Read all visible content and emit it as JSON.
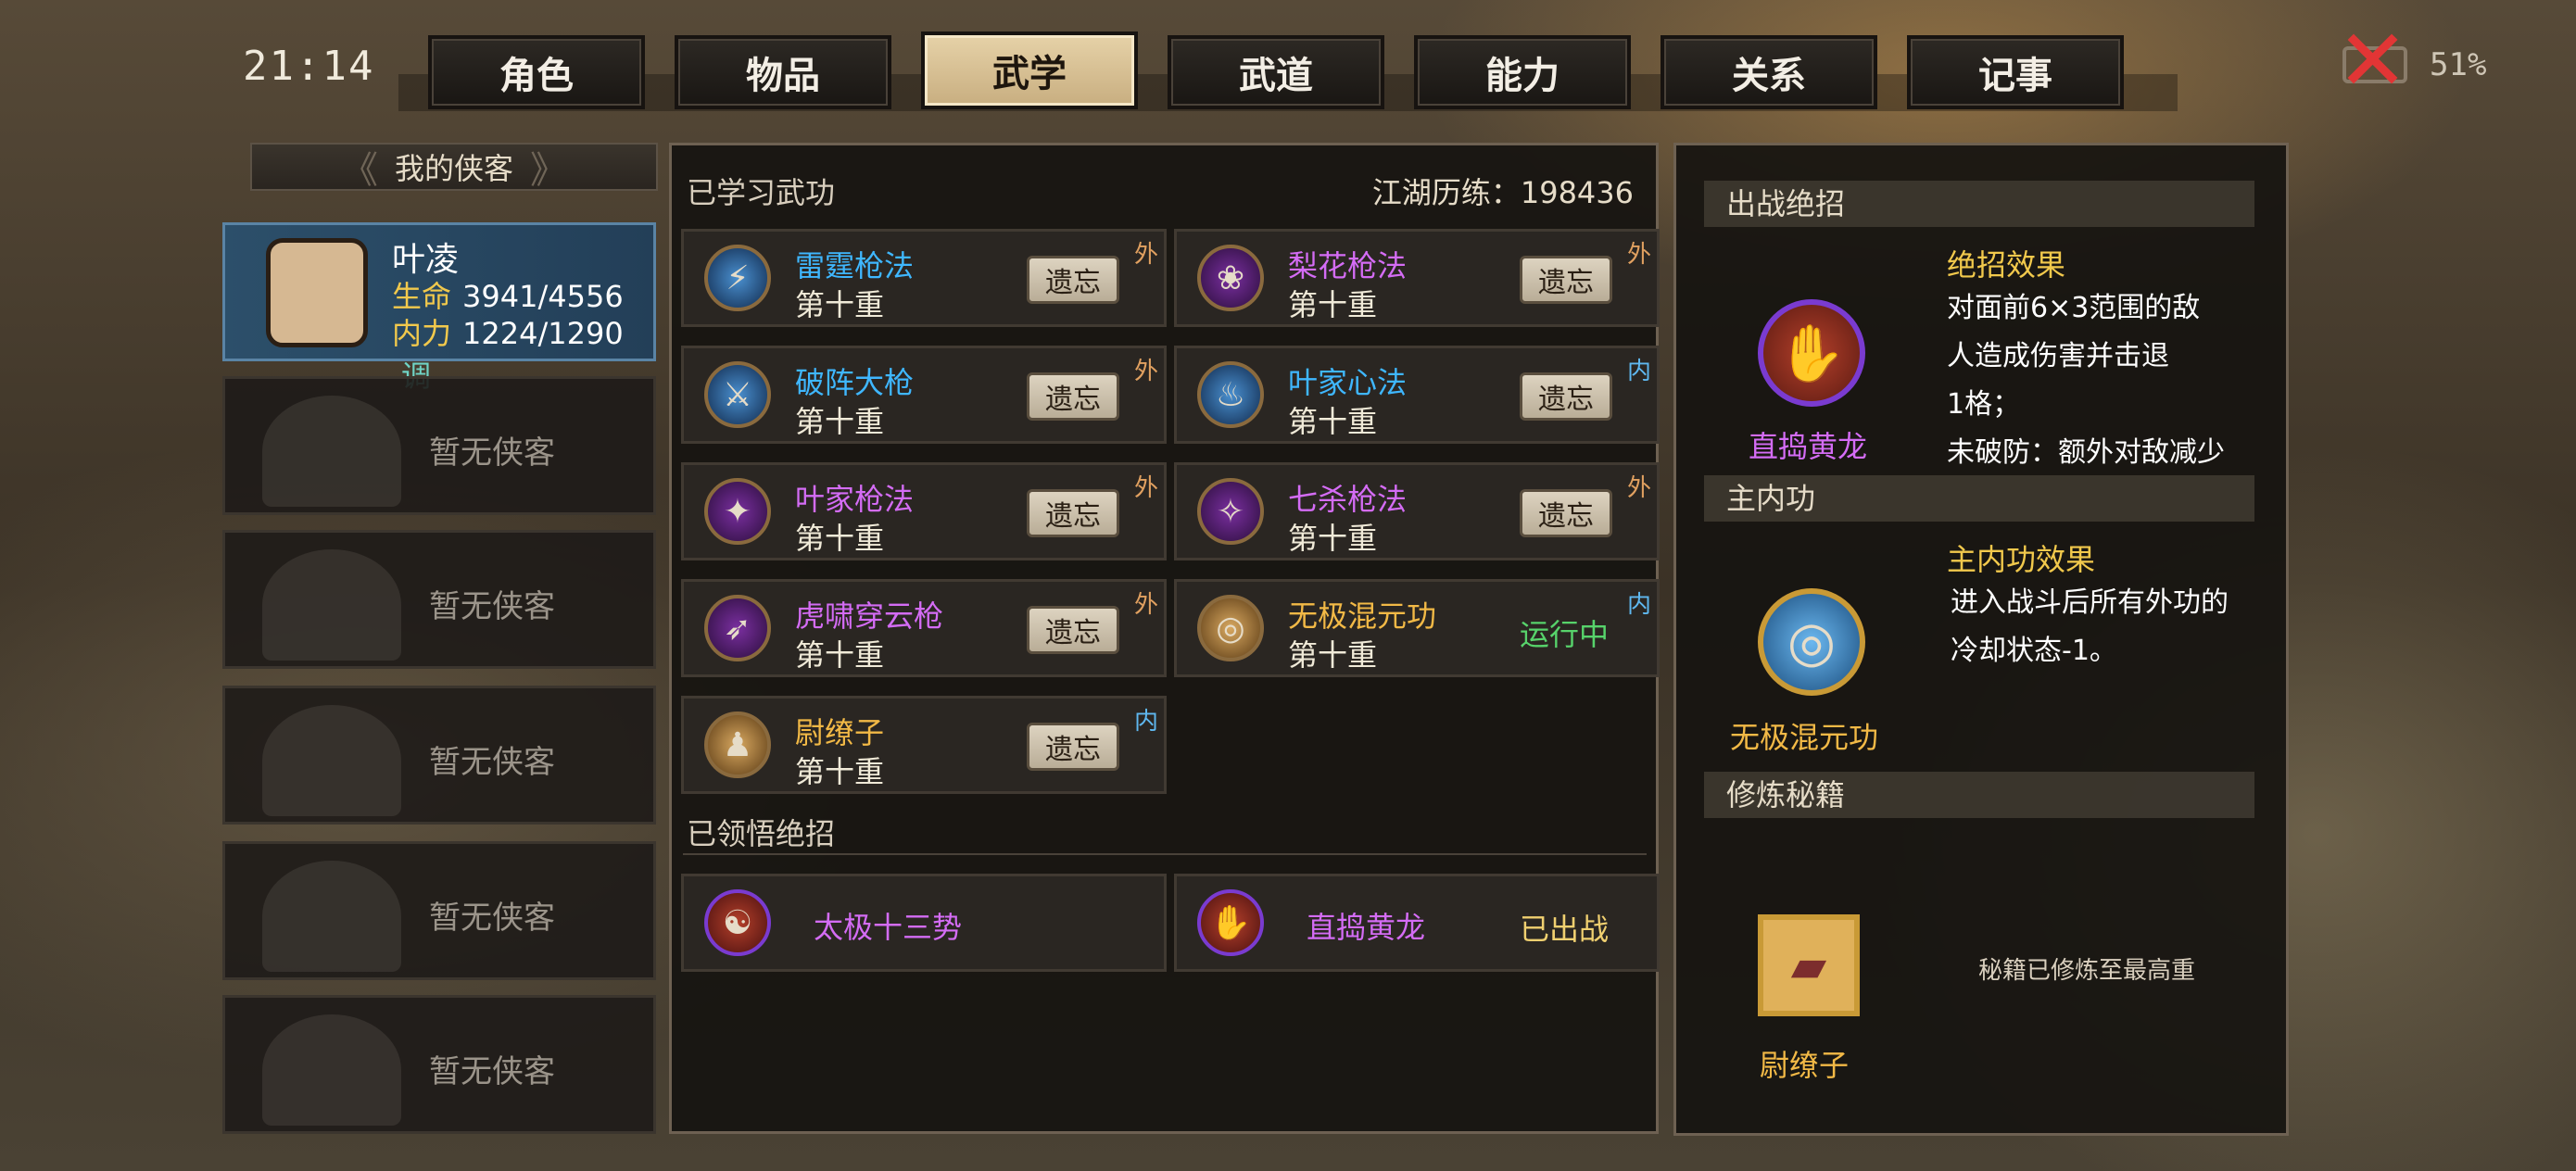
{
  "status": {
    "time": "21:14",
    "battery": "51%"
  },
  "tabs": [
    {
      "label": "角色",
      "active": false
    },
    {
      "label": "物品",
      "active": false
    },
    {
      "label": "武学",
      "active": true
    },
    {
      "label": "武道",
      "active": false
    },
    {
      "label": "能力",
      "active": false
    },
    {
      "label": "关系",
      "active": false
    },
    {
      "label": "记事",
      "active": false
    }
  ],
  "party": {
    "title": "我的侠客",
    "hero": {
      "name": "叶凌",
      "hp_label": "生命",
      "hp": "3941/4556",
      "mp_label": "内力",
      "mp": "1224/1290",
      "tune": "调"
    },
    "empty_label": "暂无侠客"
  },
  "learned": {
    "title": "已学习武功",
    "jianghu_label": "江湖历练：",
    "jianghu_value": "198436",
    "forget_label": "遗忘",
    "running_label": "运行中",
    "skills": [
      {
        "name": "雷霆枪法",
        "level": "第十重",
        "tag": "外",
        "color": "cyan",
        "icon": "lightning-spear-icon"
      },
      {
        "name": "梨花枪法",
        "level": "第十重",
        "tag": "外",
        "color": "purple",
        "icon": "pear-blossom-spear-icon"
      },
      {
        "name": "破阵大枪",
        "level": "第十重",
        "tag": "外",
        "color": "cyan",
        "icon": "formation-spear-icon"
      },
      {
        "name": "叶家心法",
        "level": "第十重",
        "tag": "内",
        "color": "cyan",
        "icon": "meditation-icon"
      },
      {
        "name": "叶家枪法",
        "level": "第十重",
        "tag": "外",
        "color": "purple",
        "icon": "ye-spear-icon"
      },
      {
        "name": "七杀枪法",
        "level": "第十重",
        "tag": "外",
        "color": "purple",
        "icon": "seven-kill-spear-icon"
      },
      {
        "name": "虎啸穿云枪",
        "level": "第十重",
        "tag": "外",
        "color": "purple",
        "icon": "tiger-spear-icon"
      },
      {
        "name": "无极混元功",
        "level": "第十重",
        "tag": "内",
        "color": "gold",
        "icon": "swirl-icon",
        "running": true
      },
      {
        "name": "尉缭子",
        "level": "第十重",
        "tag": "内",
        "color": "gold",
        "icon": "book-sage-icon"
      }
    ]
  },
  "ultimates": {
    "title": "已领悟绝招",
    "items": [
      {
        "name": "太极十三势",
        "icon": "taiji-icon",
        "status": ""
      },
      {
        "name": "直捣黄龙",
        "icon": "claw-strike-icon",
        "status": "已出战"
      }
    ]
  },
  "right": {
    "battle_title": "出战绝招",
    "battle_name": "直捣黄龙",
    "battle_effect_title": "绝招效果",
    "battle_effect_lines": [
      "对面前6×3范围的敌",
      "人造成伤害并击退",
      "1格；",
      "未破防：额外对敌减少"
    ],
    "inner_title": "主内功",
    "inner_name": "无极混元功",
    "inner_effect_title": "主内功效果",
    "inner_effect_lines": [
      "进入战斗后所有外功的",
      "冷却状态-1。"
    ],
    "book_title": "修炼秘籍",
    "book_name": "尉缭子",
    "book_status": "秘籍已修炼至最高重"
  },
  "colors": {
    "purple": "#d46cf5",
    "cyan": "#3fb7ff",
    "gold": "#f2b946",
    "running": "#57d36b",
    "deployed": "#f0d070"
  }
}
